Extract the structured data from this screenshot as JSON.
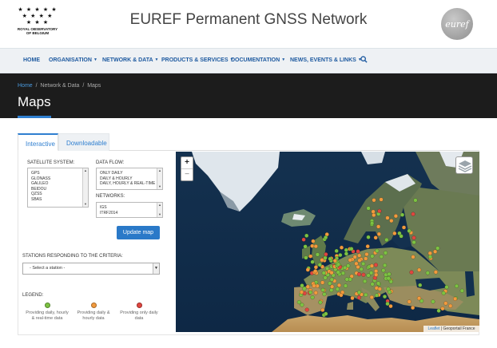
{
  "header": {
    "title": "EUREF Permanent GNSS Network",
    "org_logo": {
      "stars": [
        "★ ★ ★ ★ ★",
        "★ ★ ★ ★",
        "★ ★ ★"
      ],
      "line1": "ROYAL OBSERVATORY",
      "line2": "OF BELGIUM"
    },
    "euref_logo_text": "euref"
  },
  "nav": {
    "items": [
      {
        "label": "HOME"
      },
      {
        "label": "ORGANISATION"
      },
      {
        "label": "NETWORK & DATA"
      },
      {
        "label": "PRODUCTS & SERVICES"
      },
      {
        "label": "DOCUMENTATION"
      },
      {
        "label": "NEWS, EVENTS & LINKS"
      }
    ],
    "search_icon": "search-icon"
  },
  "breadcrumb": {
    "home": "Home",
    "sep": "/",
    "section": "Network & Data",
    "current": "Maps"
  },
  "page_title": "Maps",
  "tabs": [
    {
      "label": "Interactive",
      "active": true
    },
    {
      "label": "Downloadable",
      "active": false
    }
  ],
  "form": {
    "satellite_label": "SATELLITE SYSTEM:",
    "satellite_options": [
      "GPS",
      "GLONASS",
      "GALILEO",
      "BEIDOU",
      "QZSS",
      "SBAS"
    ],
    "dataflow_label": "DATA FLOW:",
    "dataflow_options": [
      "ONLY DAILY",
      "DAILY & HOURLY",
      "DAILY, HOURLY & REAL-TIME"
    ],
    "networks_label": "NETWORKS:",
    "networks_options": [
      "IGS",
      "ITRF2014"
    ],
    "update_button": "Update map",
    "stations_label": "STATIONS RESPONDING TO THE CRITERIA:",
    "station_select_value": "- Select a station -",
    "legend_label": "LEGEND:",
    "legend": [
      {
        "color": "#7cc242",
        "text": "Providing daily, hourly & real-time data"
      },
      {
        "color": "#f29a3d",
        "text": "Providing daily & hourly data"
      },
      {
        "color": "#e0463f",
        "text": "Providing only daily data"
      }
    ]
  },
  "map": {
    "zoom_in": "+",
    "zoom_out": "−",
    "layers_icon": "layers-icon",
    "attribution_leaflet": "Leaflet",
    "attribution_sep": " | ",
    "attribution_source": "Geoportail France"
  }
}
